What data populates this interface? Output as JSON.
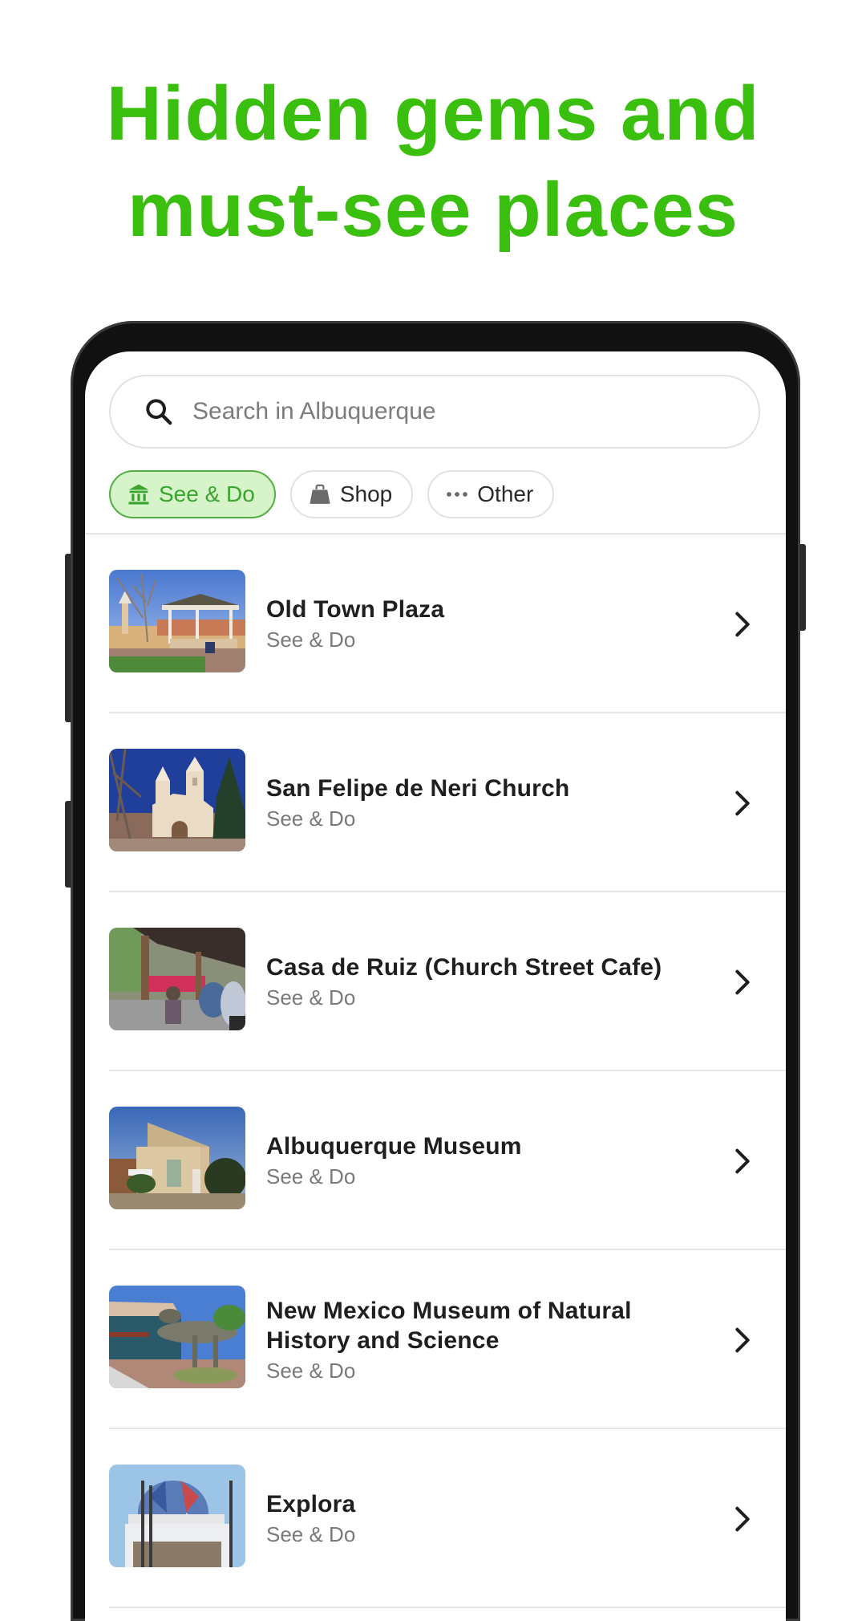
{
  "headline": {
    "line1": "Hidden gems and",
    "line2": "must-see places",
    "color": "#3abf0f"
  },
  "search": {
    "placeholder": "Search in Albuquerque",
    "value": "",
    "icon": "search-icon"
  },
  "chips": [
    {
      "label": "See & Do",
      "icon": "museum-icon",
      "active": true
    },
    {
      "label": "Shop",
      "icon": "shopping-bag-icon",
      "active": false
    },
    {
      "label": "Other",
      "icon": "more-dots-icon",
      "active": false
    }
  ],
  "colors": {
    "accent": "#3aa52d",
    "chip_active_bg": "#d6f3c9",
    "chip_active_border": "#52b043"
  },
  "places": [
    {
      "title": "Old Town Plaza",
      "category": "See & Do",
      "thumbnail": "gazebo-plaza-photo"
    },
    {
      "title": "San Felipe de Neri Church",
      "category": "See & Do",
      "thumbnail": "adobe-church-photo"
    },
    {
      "title": "Casa de Ruiz (Church Street Cafe)",
      "category": "See & Do",
      "thumbnail": "patio-cafe-photo"
    },
    {
      "title": "Albuquerque Museum",
      "category": "See & Do",
      "thumbnail": "museum-building-photo"
    },
    {
      "title": "New Mexico Museum of Natural History and Science",
      "category": "See & Do",
      "thumbnail": "dinosaur-statue-photo"
    },
    {
      "title": "Explora",
      "category": "See & Do",
      "thumbnail": "geodesic-dome-photo"
    }
  ]
}
